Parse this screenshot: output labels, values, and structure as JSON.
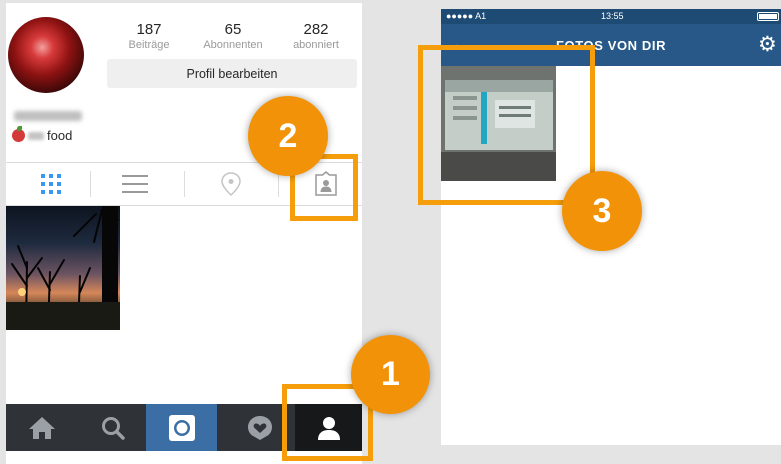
{
  "profile": {
    "stats": [
      {
        "value": "187",
        "label": "Beiträge"
      },
      {
        "value": "65",
        "label": "Abonnenten"
      },
      {
        "value": "282",
        "label": "abonniert"
      }
    ],
    "edit_button_label": "Profil bearbeiten",
    "bio_visible_text": "food",
    "tabs": [
      "grid-icon",
      "list-icon",
      "location-pin-icon",
      "tagged-photos-icon"
    ],
    "bottom_nav": [
      "home-icon",
      "search-icon",
      "camera-icon",
      "activity-icon",
      "profile-icon"
    ]
  },
  "photos_of_you": {
    "status_bar": {
      "carrier": "●●●●● A1",
      "time": "13:55"
    },
    "title": "FOTOS VON DIR",
    "back_icon": "back-arrow-icon",
    "settings_icon": "gear-icon"
  },
  "annotations": [
    {
      "number": "1",
      "target": "profile-tab"
    },
    {
      "number": "2",
      "target": "tagged-photos-tab"
    },
    {
      "number": "3",
      "target": "tagged-photo"
    }
  ],
  "colors": {
    "accent": "#f59d0a",
    "badge": "#f29208",
    "header_blue": "#275887",
    "status_blue": "#1d4b73",
    "active_nav": "#3b6ea5",
    "active_grid_icon": "#3897f0"
  }
}
